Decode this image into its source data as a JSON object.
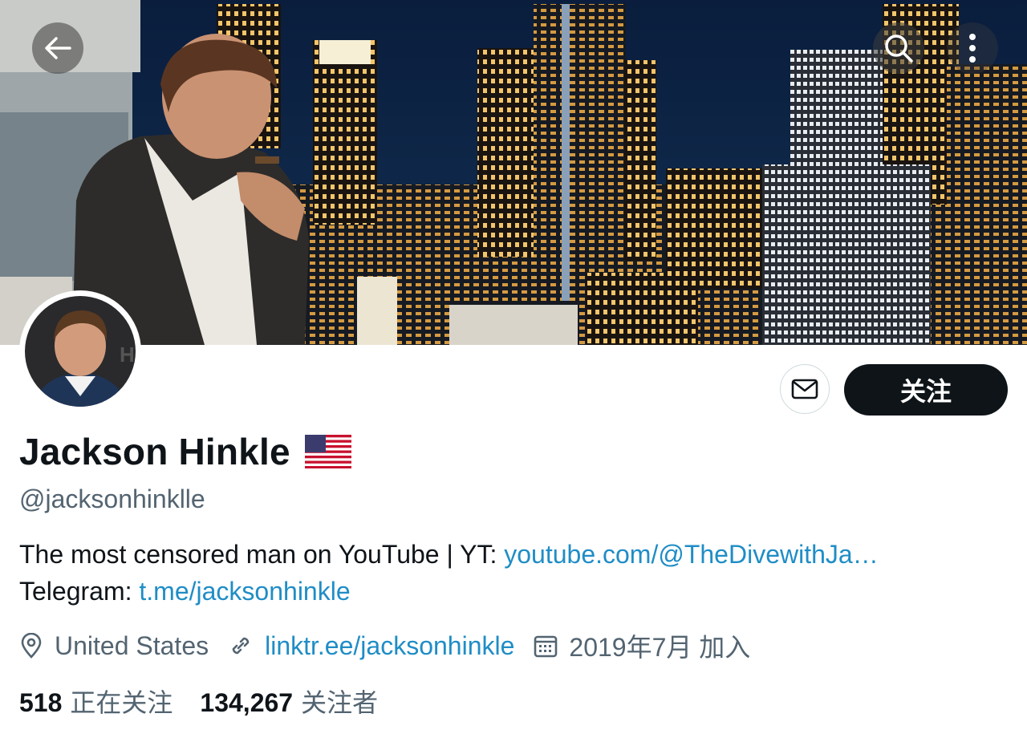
{
  "profile": {
    "display_name": "Jackson Hinkle",
    "handle": "@jacksonhinklle",
    "bio_line1_text": "The most censored man on YouTube | YT: ",
    "bio_line1_link": "youtube.com/@TheDivewithJa…",
    "bio_line2_text": "Telegram: ",
    "bio_line2_link": "t.me/jacksonhinkle",
    "location": "United States",
    "website": "linktr.ee/jacksonhinkle",
    "joined": "2019年7月 加入",
    "following_count": "518",
    "following_label": "正在关注",
    "followers_count": "134,267",
    "followers_label": "关注者"
  },
  "actions": {
    "follow_label": "关注"
  },
  "icons": {
    "back": "arrow-left-icon",
    "search": "search-icon",
    "more": "more-vertical-icon",
    "message": "envelope-icon",
    "location": "location-pin-icon",
    "link": "link-icon",
    "calendar": "calendar-icon",
    "flag": "us-flag-icon"
  },
  "colors": {
    "link": "#1f8dc6",
    "secondary_text": "#536471",
    "primary_text": "#0f1419",
    "follow_button_bg": "#0f1419"
  }
}
